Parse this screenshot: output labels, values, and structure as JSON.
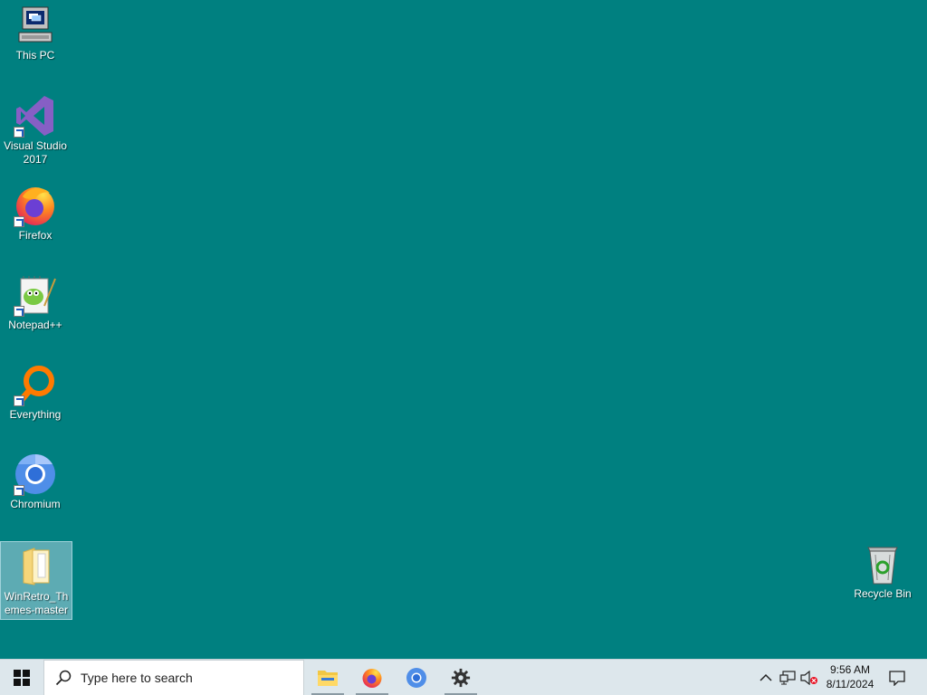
{
  "desktop": {
    "background_color": "#008080",
    "icons": [
      {
        "name": "This PC",
        "icon": "computer-icon"
      },
      {
        "name": "Visual Studio 2017",
        "icon": "visual-studio-icon"
      },
      {
        "name": "Firefox",
        "icon": "firefox-icon"
      },
      {
        "name": "Notepad++",
        "icon": "notepad-plus-plus-icon"
      },
      {
        "name": "Everything",
        "icon": "everything-search-icon"
      },
      {
        "name": "Chromium",
        "icon": "chromium-icon"
      },
      {
        "name": "WinRetro_Themes-master",
        "icon": "folder-icon",
        "selected": true
      },
      {
        "name": "Recycle Bin",
        "icon": "recycle-bin-icon"
      }
    ]
  },
  "taskbar": {
    "start_icon": "windows-logo-icon",
    "search_placeholder": "Type here to search",
    "pinned": [
      {
        "name": "File Explorer",
        "icon": "file-explorer-icon",
        "running": true
      },
      {
        "name": "Firefox",
        "icon": "firefox-icon",
        "running": true
      },
      {
        "name": "Chromium",
        "icon": "chromium-icon",
        "running": false
      },
      {
        "name": "Settings",
        "icon": "gear-icon",
        "running": true
      }
    ],
    "tray": {
      "icons": [
        "chevron-up-icon",
        "network-icon",
        "speaker-muted-icon"
      ],
      "time": "9:56 AM",
      "date": "8/11/2024",
      "notification_icon": "action-center-icon"
    }
  }
}
